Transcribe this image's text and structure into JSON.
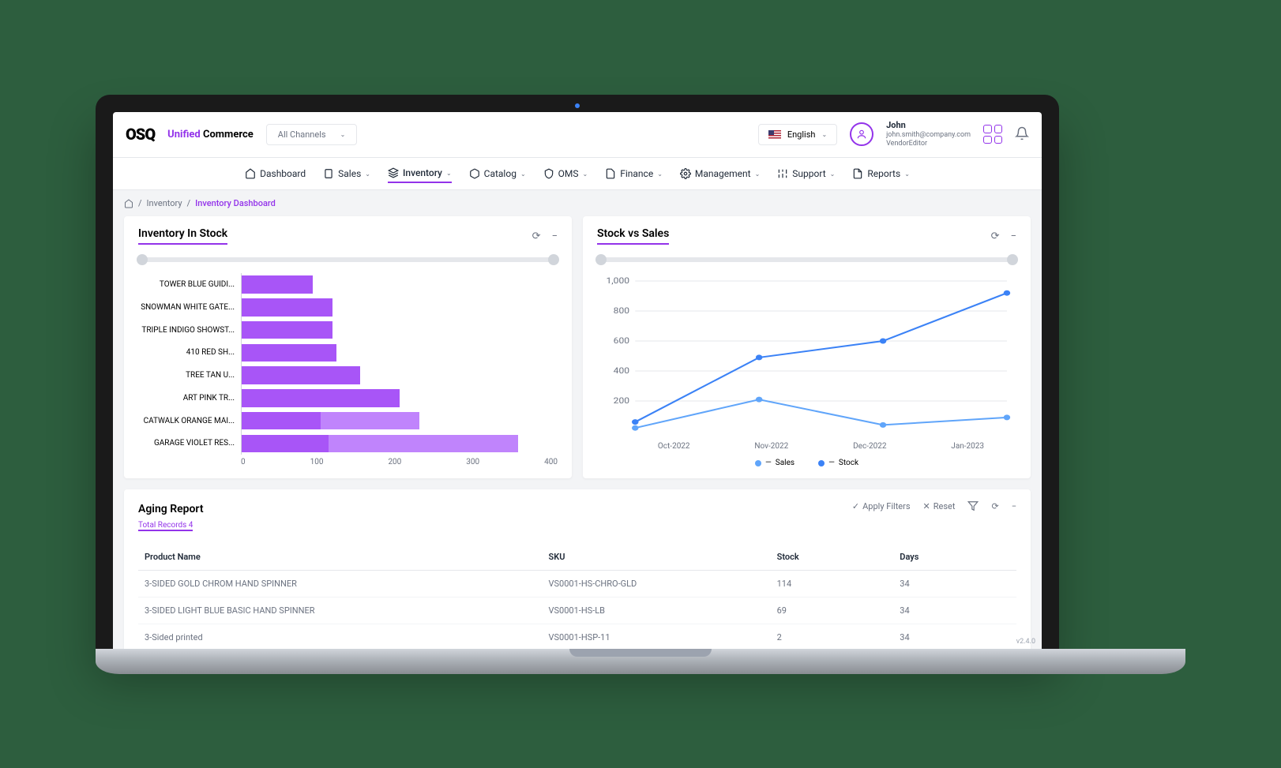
{
  "header": {
    "brand_unified": "Unified",
    "brand_commerce": "Commerce",
    "channel_label": "All Channels",
    "lang_label": "English",
    "user": {
      "name": "John",
      "email": "john.smith@company.com",
      "role": "VendorEditor"
    }
  },
  "nav": {
    "dashboard": "Dashboard",
    "sales": "Sales",
    "inventory": "Inventory",
    "catalog": "Catalog",
    "oms": "OMS",
    "finance": "Finance",
    "management": "Management",
    "support": "Support",
    "reports": "Reports"
  },
  "breadcrumb": {
    "inventory": "Inventory",
    "current": "Inventory Dashboard"
  },
  "inventory_card": {
    "title": "Inventory In Stock"
  },
  "stock_card": {
    "title": "Stock vs Sales",
    "legend_sales": "Sales",
    "legend_stock": "Stock"
  },
  "aging_card": {
    "title": "Aging Report",
    "subtitle": "Total Records 4",
    "apply_filters": "Apply Filters",
    "reset": "Reset",
    "col_product": "Product Name",
    "col_sku": "SKU",
    "col_stock": "Stock",
    "col_days": "Days",
    "rows": [
      {
        "product": "3-SIDED GOLD CHROM HAND SPINNER",
        "sku": "VS0001-HS-CHRO-GLD",
        "stock": "114",
        "days": "34"
      },
      {
        "product": "3-SIDED LIGHT BLUE BASIC HAND SPINNER",
        "sku": "VS0001-HS-LB",
        "stock": "69",
        "days": "34"
      },
      {
        "product": "3-Sided printed",
        "sku": "VS0001-HSP-11",
        "stock": "2",
        "days": "34"
      }
    ]
  },
  "chart_data": [
    {
      "type": "bar",
      "orientation": "horizontal",
      "title": "Inventory In Stock",
      "xlabel": "",
      "ylabel": "",
      "xlim": [
        0,
        400
      ],
      "xticks": [
        0,
        100,
        200,
        300,
        400
      ],
      "categories": [
        "TOWER BLUE GUIDI...",
        "SNOWMAN WHITE GATE...",
        "TRIPLE INDIGO SHOWST...",
        "410 RED SH...",
        "TREE TAN U...",
        "ART PINK TR...",
        "CATWALK ORANGE MAI...",
        "GARAGE VIOLET RES..."
      ],
      "series": [
        {
          "name": "dark",
          "values": [
            90,
            115,
            115,
            120,
            150,
            200,
            100,
            110
          ],
          "color": "#a855f7"
        },
        {
          "name": "light_total",
          "values": [
            90,
            115,
            115,
            120,
            150,
            200,
            225,
            350
          ],
          "color": "#c084fc"
        }
      ]
    },
    {
      "type": "line",
      "title": "Stock vs Sales",
      "xlabel": "",
      "ylabel": "",
      "ylim": [
        0,
        1000
      ],
      "yticks": [
        200,
        400,
        600,
        800,
        1000
      ],
      "categories": [
        "Oct-2022",
        "Nov-2022",
        "Dec-2022",
        "Jan-2023"
      ],
      "series": [
        {
          "name": "Sales",
          "values": [
            20,
            210,
            40,
            90
          ],
          "color": "#60a5fa"
        },
        {
          "name": "Stock",
          "values": [
            60,
            490,
            600,
            920
          ],
          "color": "#3b82f6"
        }
      ]
    }
  ],
  "version": "v2.4.0"
}
